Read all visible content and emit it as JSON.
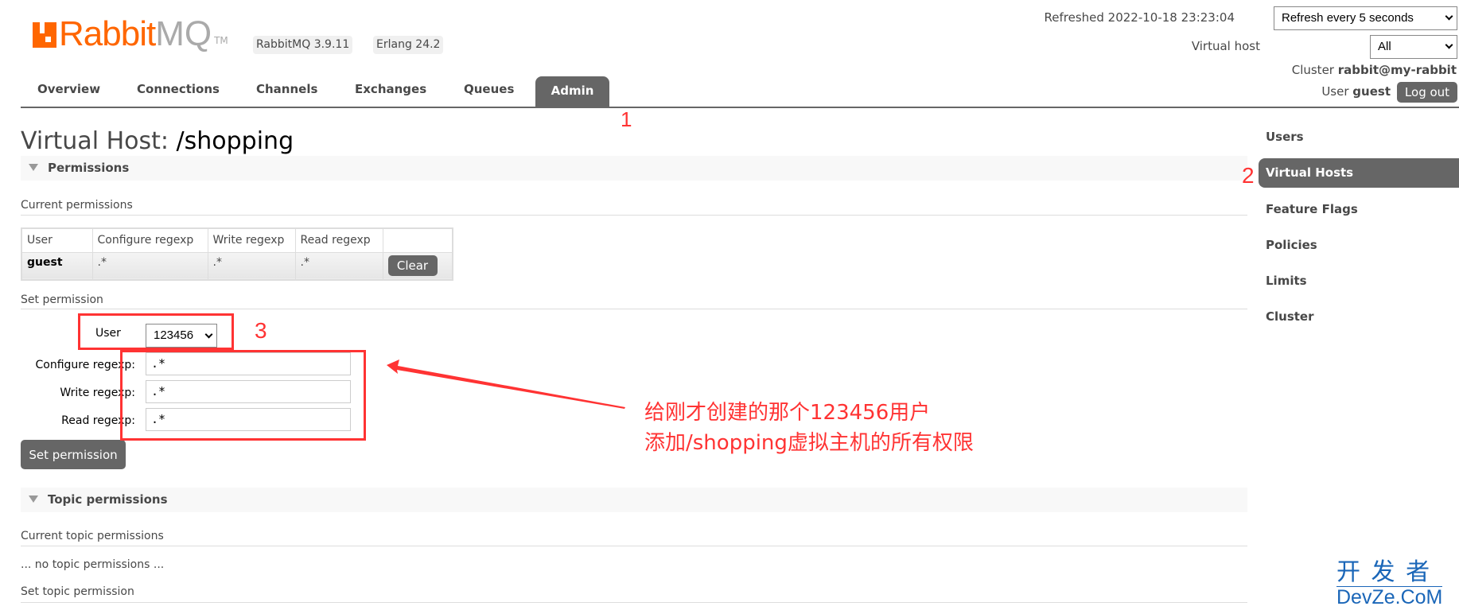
{
  "header": {
    "logo_text": "RabbitMQ",
    "badges": [
      "RabbitMQ 3.9.11",
      "Erlang 24.2"
    ],
    "refreshed": "Refreshed 2022-10-18 23:23:04",
    "refresh_select": "Refresh every 5 seconds",
    "vhost_label": "Virtual host",
    "vhost_select": "All",
    "cluster_label": "Cluster",
    "cluster_name": "rabbit@my-rabbit",
    "user_label": "User",
    "user_name": "guest",
    "logout": "Log out"
  },
  "nav": {
    "tabs": [
      "Overview",
      "Connections",
      "Channels",
      "Exchanges",
      "Queues",
      "Admin"
    ],
    "active": "Admin"
  },
  "sidebar": {
    "items": [
      "Users",
      "Virtual Hosts",
      "Feature Flags",
      "Policies",
      "Limits",
      "Cluster"
    ],
    "active": "Virtual Hosts"
  },
  "page": {
    "title_prefix": "Virtual Host:",
    "title_name": "/shopping",
    "permissions": {
      "section": "Permissions",
      "current": "Current permissions",
      "columns": [
        "User",
        "Configure regexp",
        "Write regexp",
        "Read regexp"
      ],
      "rows": [
        {
          "user": "guest",
          "configure": ".*",
          "write": ".*",
          "read": ".*",
          "action": "Clear"
        }
      ],
      "set": "Set permission",
      "form": {
        "user_label": "User",
        "user_value": "123456",
        "configure_label": "Configure regexp:",
        "configure_value": ".*",
        "write_label": "Write regexp:",
        "write_value": ".*",
        "read_label": "Read regexp:",
        "read_value": ".*",
        "submit": "Set permission"
      }
    },
    "topic": {
      "section": "Topic permissions",
      "current": "Current topic permissions",
      "empty": "... no topic permissions ...",
      "set": "Set topic permission"
    }
  },
  "annotations": {
    "markers": [
      "1",
      "2",
      "3"
    ],
    "note_line1": "给刚才创建的那个123456用户",
    "note_line2": "添加/shopping虚拟主机的所有权限",
    "color": "#ff3333"
  },
  "watermark": {
    "line1": "开 发 者",
    "line2": "DevZe.CoM"
  },
  "colors": {
    "brand": "#ff6600",
    "active": "#666666"
  }
}
